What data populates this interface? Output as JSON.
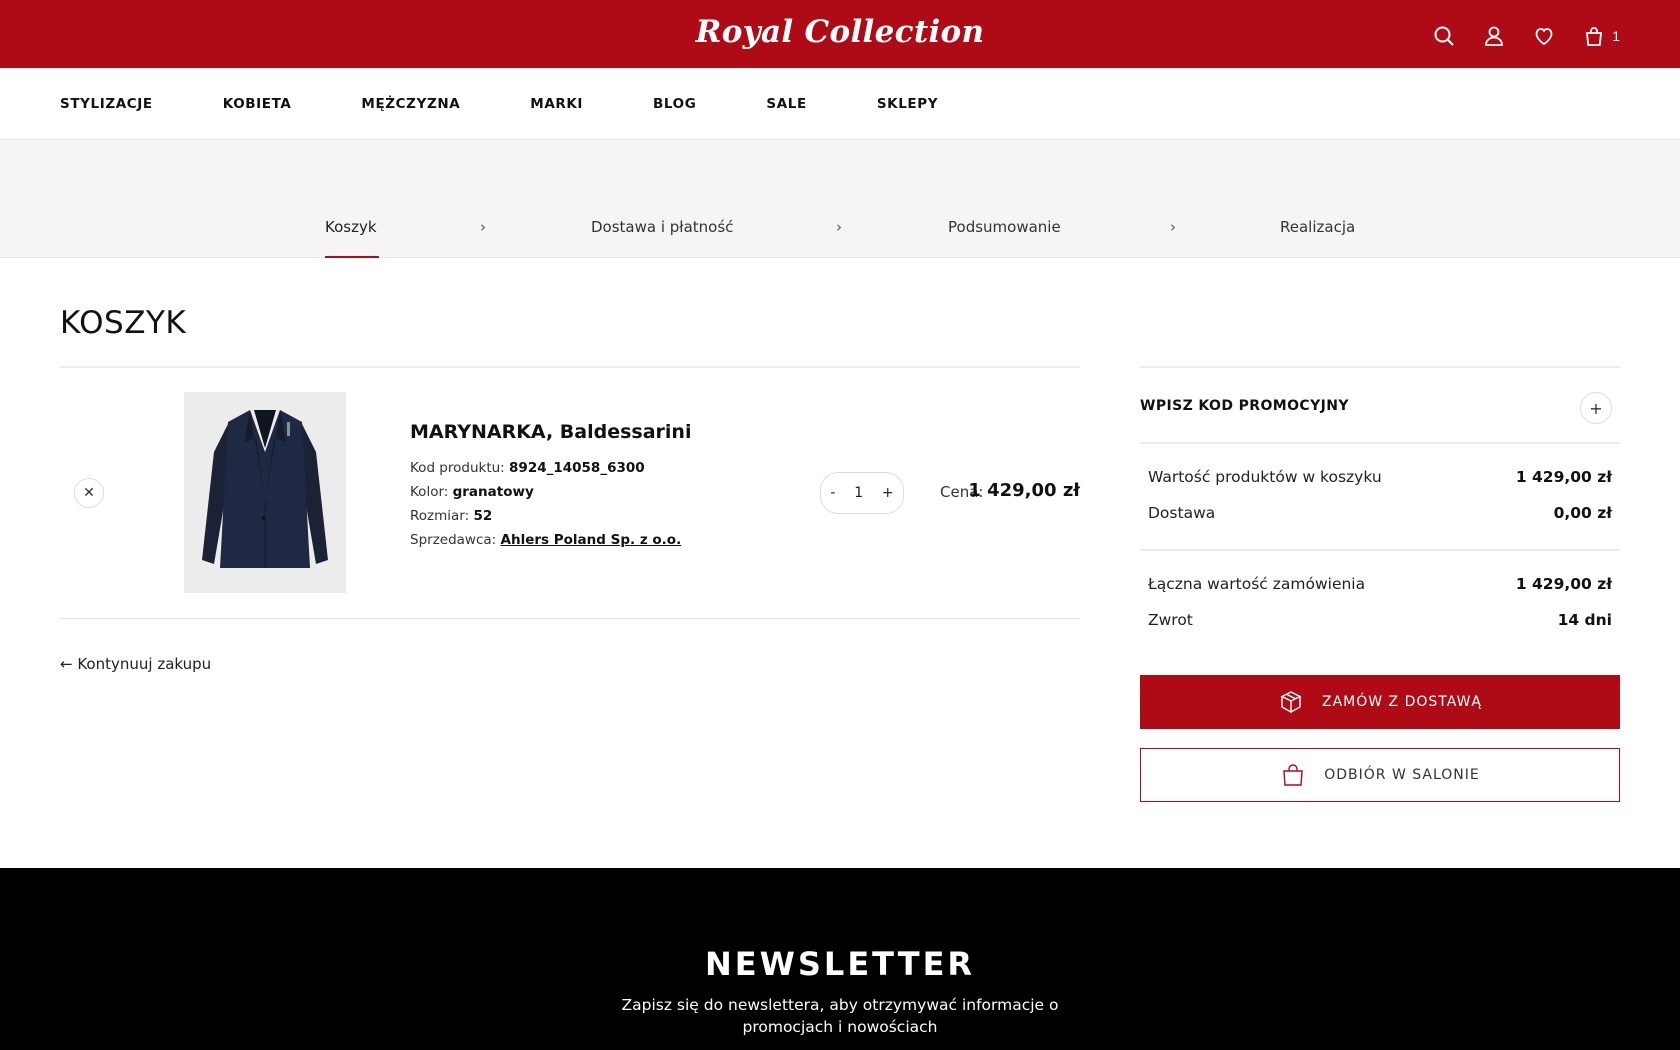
{
  "header": {
    "logo": "Royal Collection",
    "cart_count": "1",
    "icons": [
      "search-icon",
      "user-icon",
      "heart-icon",
      "bag-icon"
    ]
  },
  "nav": {
    "items": [
      "STYLIZACJE",
      "KOBIETA",
      "MĘŻCZYZNA",
      "MARKI",
      "BLOG",
      "SALE",
      "SKLEPY"
    ]
  },
  "steps": [
    "Koszyk",
    "Dostawa i płatność",
    "Podsumowanie",
    "Realizacja"
  ],
  "cart": {
    "title": "KOSZYK",
    "item": {
      "name": "MARYNARKA, Baldessarini",
      "code_label": "Kod produktu:",
      "code": "8924_14058_6300",
      "color_label": "Kolor:",
      "color": "granatowy",
      "size_label": "Rozmiar:",
      "size": "52",
      "seller_label": "Sprzedawca:",
      "seller": "Ahlers Poland Sp. z o.o.",
      "qty_minus": "-",
      "qty": "1",
      "qty_plus": "+",
      "price_label": "Cena:",
      "price": "1 429,00 zł"
    },
    "continue": "← Kontynuuj zakupu"
  },
  "summary": {
    "promo_label": "WPISZ KOD PROMOCYJNY",
    "promo_plus": "+",
    "products_label": "Wartość produktów w koszyku",
    "products_value": "1 429,00 zł",
    "delivery_label": "Dostawa",
    "delivery_value": "0,00 zł",
    "total_label": "Łączna wartość zamówienia",
    "total_value": "1 429,00 zł",
    "return_label": "Zwrot",
    "return_value": "14 dni",
    "btn_delivery": "ZAMÓW Z DOSTAWĄ",
    "btn_pickup": "ODBIÓR W SALONIE"
  },
  "footer": {
    "newsletter_title": "NEWSLETTER",
    "newsletter_text": "Zapisz się do newslettera, aby otrzymywać informacje o promocjach i nowościach"
  },
  "colors": {
    "brand_red": "#ae0b16",
    "footer_bg": "#000000"
  }
}
